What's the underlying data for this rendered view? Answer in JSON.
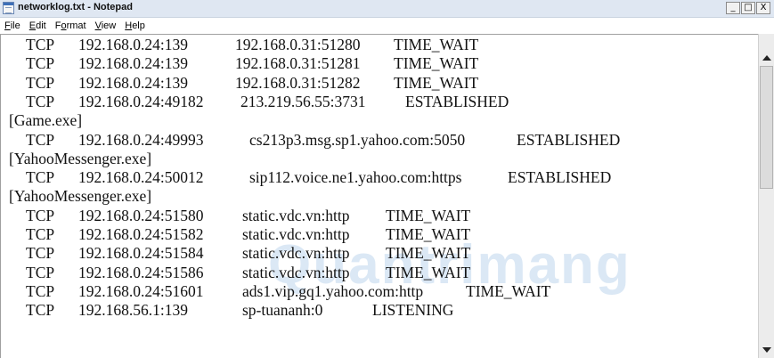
{
  "window": {
    "title": "networklog.txt - Notepad",
    "buttons": [
      "_",
      "□",
      "X"
    ]
  },
  "menu": [
    {
      "key": "F",
      "rest": "ile"
    },
    {
      "key": "E",
      "rest": "dit"
    },
    {
      "key": "F",
      "rest": "o",
      "prefix": "",
      "full": "Format",
      "underline_index": 1
    },
    {
      "key": "V",
      "rest": "iew"
    },
    {
      "key": "H",
      "rest": "elp"
    }
  ],
  "lines": [
    {
      "cols": [
        "TCP",
        "192.168.0.24:139",
        "192.168.0.31:51280",
        "TIME_WAIT"
      ]
    },
    {
      "cols": [
        "TCP",
        "192.168.0.24:139",
        "192.168.0.31:51281",
        "TIME_WAIT"
      ]
    },
    {
      "cols": [
        "TCP",
        "192.168.0.24:139",
        "192.168.0.31:51282",
        "TIME_WAIT"
      ]
    },
    {
      "cols": [
        "TCP",
        "192.168.0.24:49182",
        "213.219.56.55:3731",
        "ESTABLISHED"
      ]
    },
    {
      "text": "[Game.exe]"
    },
    {
      "cols": [
        "TCP",
        "192.168.0.24:49993",
        "cs213p3.msg.sp1.yahoo.com:5050",
        "ESTABLISHED"
      ]
    },
    {
      "text": "[YahooMessenger.exe]"
    },
    {
      "cols": [
        "TCP",
        "192.168.0.24:50012",
        "sip112.voice.ne1.yahoo.com:https",
        "ESTABLISHED"
      ]
    },
    {
      "text": "[YahooMessenger.exe]"
    },
    {
      "cols": [
        "TCP",
        "192.168.0.24:51580",
        "static.vdc.vn:http",
        "TIME_WAIT"
      ]
    },
    {
      "cols": [
        "TCP",
        "192.168.0.24:51582",
        "static.vdc.vn:http",
        "TIME_WAIT"
      ]
    },
    {
      "cols": [
        "TCP",
        "192.168.0.24:51584",
        "static.vdc.vn:http",
        "TIME_WAIT"
      ]
    },
    {
      "cols": [
        "TCP",
        "192.168.0.24:51586",
        "static.vdc.vn:http",
        "TIME_WAIT"
      ]
    },
    {
      "cols": [
        "TCP",
        "192.168.0.24:51601",
        "ads1.vip.gq1.yahoo.com:http",
        "TIME_WAIT"
      ]
    },
    {
      "cols": [
        "TCP",
        "192.168.56.1:139",
        "sp-tuananh:0",
        "LISTENING"
      ]
    }
  ],
  "watermark": "Quantrimang"
}
